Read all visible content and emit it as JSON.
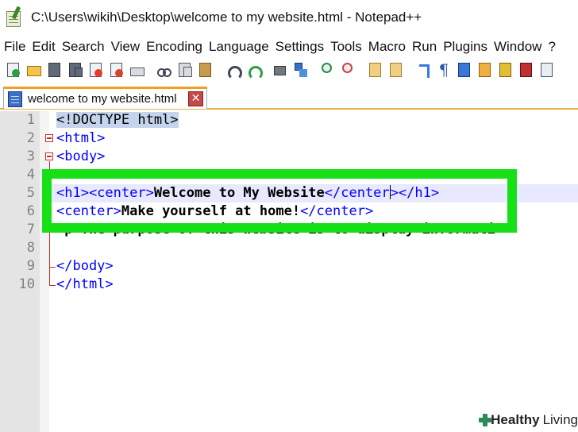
{
  "window": {
    "title": "C:\\Users\\wikih\\Desktop\\welcome to my website.html - Notepad++"
  },
  "menu": [
    "File",
    "Edit",
    "Search",
    "View",
    "Encoding",
    "Language",
    "Settings",
    "Tools",
    "Macro",
    "Run",
    "Plugins",
    "Window",
    "?"
  ],
  "toolbar": {
    "icons": [
      "new-file-icon",
      "open-file-icon",
      "save-icon",
      "save-all-icon",
      "close-icon",
      "close-all-icon",
      "print-icon",
      "cut-icon",
      "copy-icon",
      "paste-icon",
      "undo-icon",
      "redo-icon",
      "find-icon",
      "replace-icon",
      "zoom-in-icon",
      "zoom-out-icon",
      "sync-vertical-icon",
      "sync-horizontal-icon",
      "word-wrap-icon",
      "show-all-chars-icon",
      "indent-guide-icon",
      "language-icon",
      "user-defined-language-icon",
      "document-map-icon",
      "function-list-icon"
    ],
    "pilcrow": "¶"
  },
  "tabs": [
    {
      "label": "welcome to my website.html",
      "active": true,
      "close": "✕"
    }
  ],
  "editor": {
    "line_numbers": [
      "1",
      "2",
      "3",
      "4",
      "5",
      "6",
      "7",
      "8",
      "9",
      "10"
    ],
    "lines": {
      "l1": "<!DOCTYPE html>",
      "l2": "<html>",
      "l3": "<body>",
      "l5_open": "<h1><center>",
      "l5_text": "Welcome to My Website",
      "l5_close1": "</center",
      "l5_close1b": ">",
      "l5_close2": "</h1>",
      "l6_open": "<center>",
      "l6_text": "Make yourself at home!",
      "l6_close": "</center>",
      "l7": "<p>The purpose of this website is to display informati",
      "l9": "</body>",
      "l10": "</html>"
    },
    "highlight_color": "#17e017"
  },
  "watermark": {
    "bold": "Healthy",
    "regular": "Living"
  }
}
